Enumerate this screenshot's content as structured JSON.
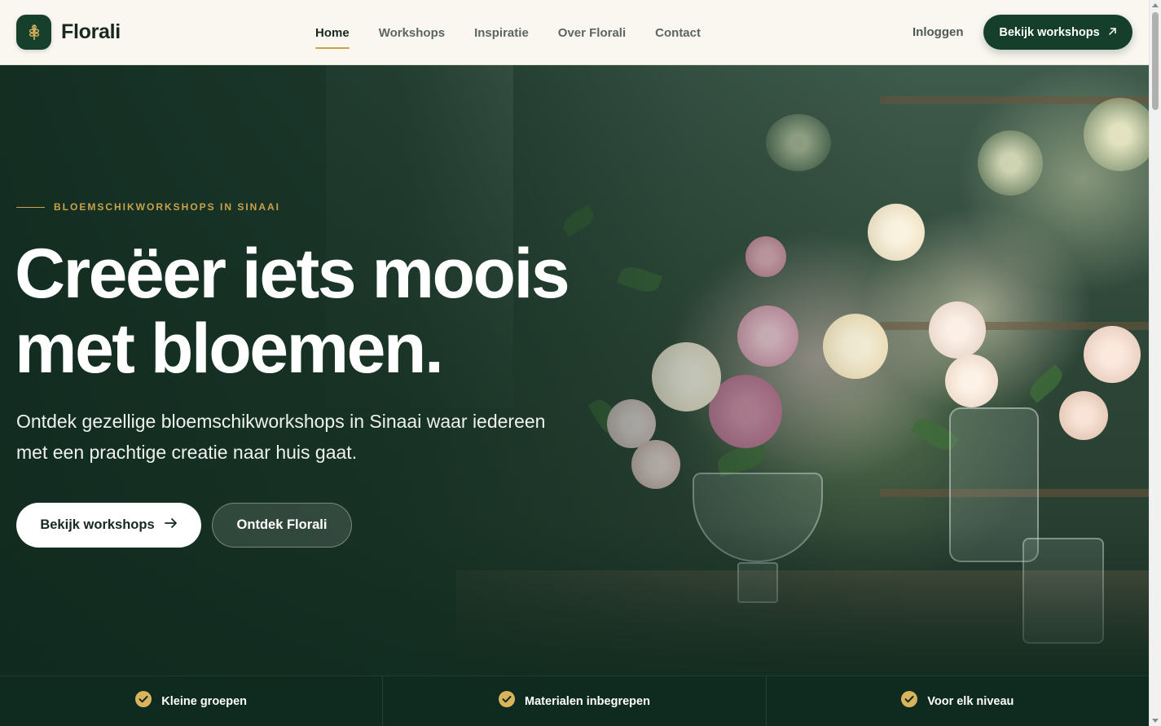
{
  "header": {
    "brand": "Florali",
    "nav": [
      {
        "label": "Home",
        "active": true
      },
      {
        "label": "Workshops",
        "active": false
      },
      {
        "label": "Inspiratie",
        "active": false
      },
      {
        "label": "Over Florali",
        "active": false
      },
      {
        "label": "Contact",
        "active": false
      }
    ],
    "login_label": "Inloggen",
    "cta_label": "Bekijk workshops",
    "cta_icon": "arrow-up-right-icon"
  },
  "hero": {
    "eyebrow": "BLOEMSCHIKWORKSHOPS IN SINAAI",
    "title_line1": "Creëer iets moois",
    "title_line2": "met bloemen.",
    "subtitle": "Ontdek gezellige bloemschikworkshops in Sinaai waar iedereen met een prachtige creatie naar huis gaat.",
    "primary_label": "Bekijk workshops",
    "primary_icon": "arrow-right-icon",
    "secondary_label": "Ontdek Florali"
  },
  "features": [
    {
      "label": "Kleine groepen",
      "icon": "check-circle-icon"
    },
    {
      "label": "Materialen inbegrepen",
      "icon": "check-circle-icon"
    },
    {
      "label": "Voor elk niveau",
      "icon": "check-circle-icon"
    }
  ],
  "colors": {
    "brand_green": "#153f2b",
    "accent_gold": "#c9a24a",
    "header_bg": "#faf7f0"
  }
}
